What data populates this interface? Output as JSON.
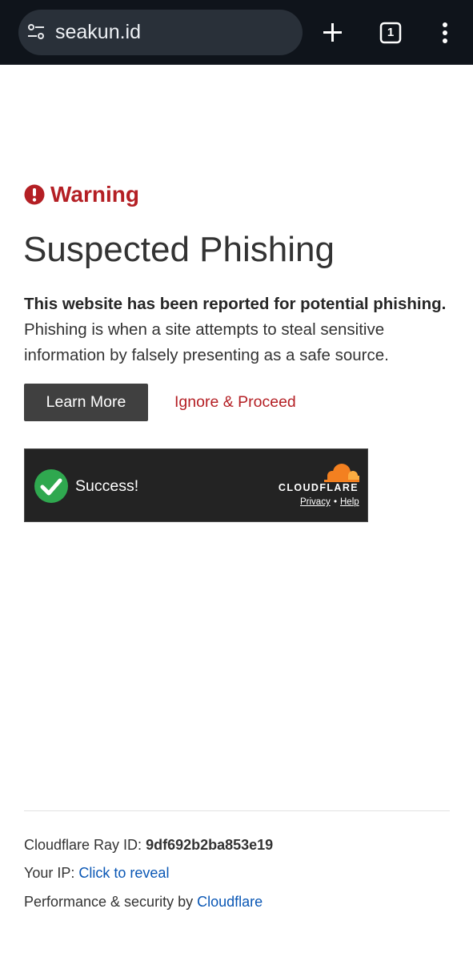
{
  "browser": {
    "url": "seakun.id",
    "tab_count": "1",
    "icons": [
      "tune-icon",
      "plus-icon",
      "tabs-icon",
      "more-vert-icon"
    ]
  },
  "warning": {
    "label": "Warning",
    "icon": "exclamation-circle-icon",
    "color": "#b41f24"
  },
  "page": {
    "title": "Suspected Phishing",
    "description_bold": "This website has been reported for potential phishing.",
    "description_rest": "Phishing is when a site attempts to steal sensitive information by falsely presenting as a safe source."
  },
  "actions": {
    "learn_more": "Learn More",
    "ignore": "Ignore & Proceed"
  },
  "widget": {
    "status": "Success!",
    "brand": "CLOUDFLARE",
    "privacy": "Privacy",
    "separator": "•",
    "help": "Help",
    "brand_color": "#f38020",
    "success_color": "#2fa84f"
  },
  "footer": {
    "ray_label": "Cloudflare Ray ID:",
    "ray_id": "9df692b2ba853e19",
    "ip_label": "Your IP:",
    "ip_link": "Click to reveal",
    "perf_label": "Performance & security by",
    "perf_link": "Cloudflare",
    "link_color": "#0a57b5"
  }
}
